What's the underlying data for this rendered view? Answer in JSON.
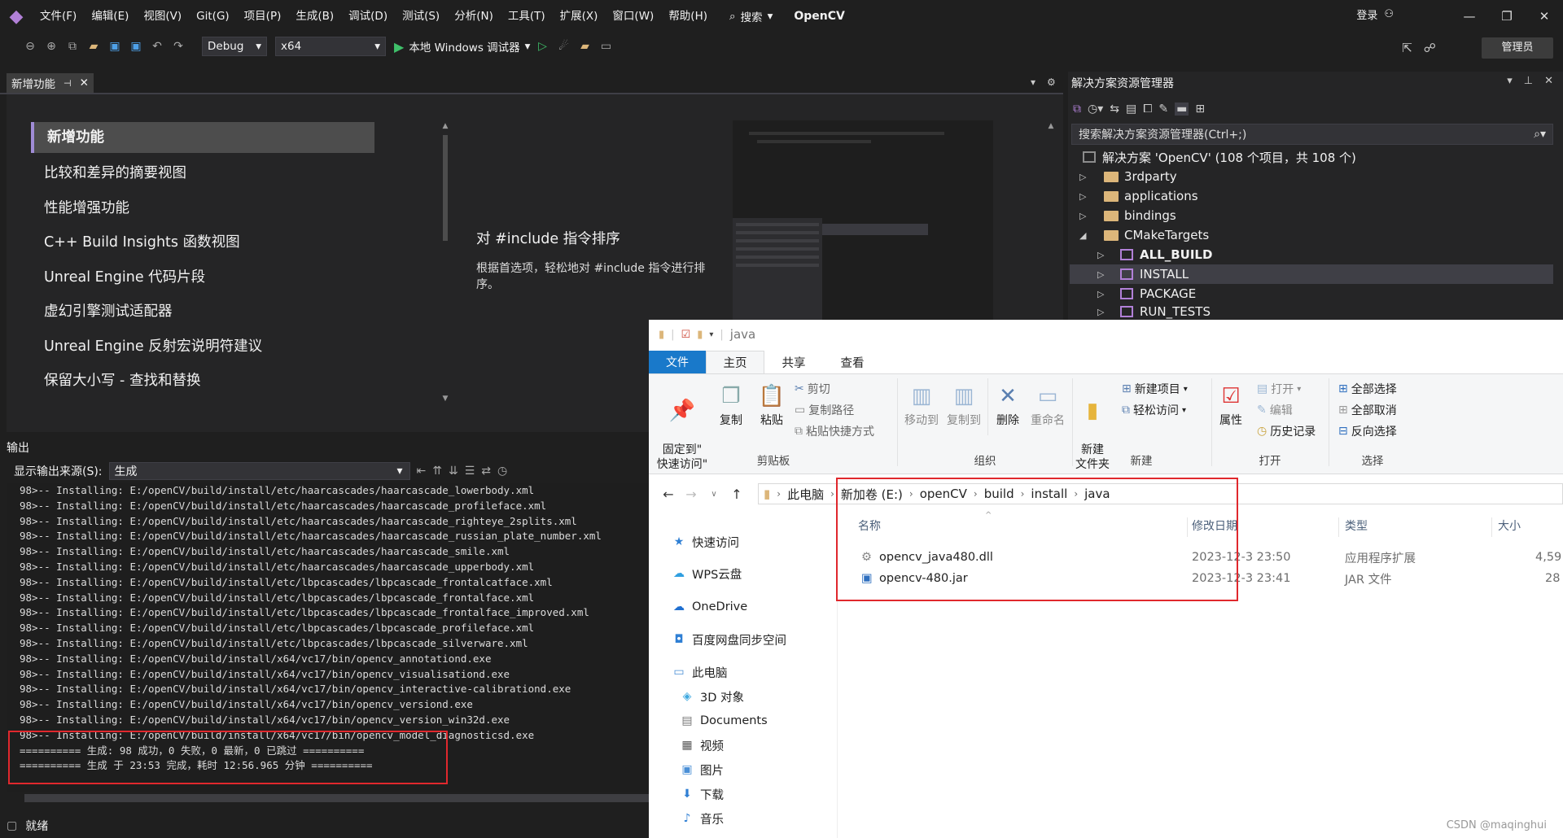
{
  "vs": {
    "menu": [
      "文件(F)",
      "编辑(E)",
      "视图(V)",
      "Git(G)",
      "项目(P)",
      "生成(B)",
      "调试(D)",
      "测试(S)",
      "分析(N)",
      "工具(T)",
      "扩展(X)",
      "窗口(W)",
      "帮助(H)"
    ],
    "search_label": "搜索",
    "solution_name": "OpenCV",
    "login_label": "登录",
    "config": "Debug",
    "platform": "x64",
    "run_label": "本地 Windows 调试器",
    "admin_label": "管理员"
  },
  "whats_new": {
    "tab_label": "新增功能",
    "items": [
      "新增功能",
      "比较和差异的摘要视图",
      "性能增强功能",
      "C++ Build Insights 函数视图",
      "Unreal Engine 代码片段",
      "虚幻引擎测试适配器",
      "Unreal Engine 反射宏说明符建议",
      "保留大小写 - 查找和替换"
    ],
    "feature_title": "对 #include 指令排序",
    "feature_desc": "根据首选项，轻松地对 #include 指令进行排序。"
  },
  "output": {
    "title": "输出",
    "source_label": "显示输出来源(S):",
    "source_value": "生成",
    "lines": [
      "98>-- Installing: E:/openCV/build/install/etc/haarcascades/haarcascade_lowerbody.xml",
      "98>-- Installing: E:/openCV/build/install/etc/haarcascades/haarcascade_profileface.xml",
      "98>-- Installing: E:/openCV/build/install/etc/haarcascades/haarcascade_righteye_2splits.xml",
      "98>-- Installing: E:/openCV/build/install/etc/haarcascades/haarcascade_russian_plate_number.xml",
      "98>-- Installing: E:/openCV/build/install/etc/haarcascades/haarcascade_smile.xml",
      "98>-- Installing: E:/openCV/build/install/etc/haarcascades/haarcascade_upperbody.xml",
      "98>-- Installing: E:/openCV/build/install/etc/lbpcascades/lbpcascade_frontalcatface.xml",
      "98>-- Installing: E:/openCV/build/install/etc/lbpcascades/lbpcascade_frontalface.xml",
      "98>-- Installing: E:/openCV/build/install/etc/lbpcascades/lbpcascade_frontalface_improved.xml",
      "98>-- Installing: E:/openCV/build/install/etc/lbpcascades/lbpcascade_profileface.xml",
      "98>-- Installing: E:/openCV/build/install/etc/lbpcascades/lbpcascade_silverware.xml",
      "98>-- Installing: E:/openCV/build/install/x64/vc17/bin/opencv_annotationd.exe",
      "98>-- Installing: E:/openCV/build/install/x64/vc17/bin/opencv_visualisationd.exe",
      "98>-- Installing: E:/openCV/build/install/x64/vc17/bin/opencv_interactive-calibrationd.exe",
      "98>-- Installing: E:/openCV/build/install/x64/vc17/bin/opencv_versiond.exe",
      "98>-- Installing: E:/openCV/build/install/x64/vc17/bin/opencv_version_win32d.exe",
      "98>-- Installing: E:/openCV/build/install/x64/vc17/bin/opencv_model_diagnosticsd.exe",
      "========== 生成: 98 成功，0 失败，0 最新，0 已跳过 ==========",
      "========== 生成 于 23:53 完成，耗时 12:56.965 分钟 =========="
    ]
  },
  "status": {
    "text": "就绪"
  },
  "solution_explorer": {
    "title": "解决方案资源管理器",
    "search_placeholder": "搜索解决方案资源管理器(Ctrl+;)",
    "solution_label": "解决方案 'OpenCV' (108 个项目，共 108 个)",
    "folders": [
      "3rdparty",
      "applications",
      "bindings",
      "CMakeTargets"
    ],
    "targets": [
      "ALL_BUILD",
      "INSTALL",
      "PACKAGE",
      "RUN_TESTS"
    ]
  },
  "explorer": {
    "window_title": "java",
    "tabs": [
      "文件",
      "主页",
      "共享",
      "查看"
    ],
    "ribbon": {
      "pin": "固定到\"\n快速访问\"",
      "copy": "复制",
      "paste": "粘贴",
      "cut": "剪切",
      "copy_path": "复制路径",
      "paste_shortcut": "粘贴快捷方式",
      "clipboard": "剪贴板",
      "move_to": "移动到",
      "copy_to": "复制到",
      "delete": "删除",
      "rename": "重命名",
      "organize": "组织",
      "new_folder": "新建\n文件夹",
      "new_item": "新建项目",
      "easy_access": "轻松访问",
      "new": "新建",
      "properties": "属性",
      "open": "打开",
      "edit": "编辑",
      "history": "历史记录",
      "open_group": "打开",
      "select_all": "全部选择",
      "select_none": "全部取消",
      "invert": "反向选择",
      "select": "选择"
    },
    "breadcrumb": [
      "此电脑",
      "新加卷 (E:)",
      "openCV",
      "build",
      "install",
      "java"
    ],
    "nav": [
      "快速访问",
      "WPS云盘",
      "OneDrive",
      "百度网盘同步空间",
      "此电脑",
      "3D 对象",
      "Documents",
      "视频",
      "图片",
      "下载",
      "音乐"
    ],
    "columns": [
      "名称",
      "修改日期",
      "类型",
      "大小"
    ],
    "files": [
      {
        "name": "opencv_java480.dll",
        "date": "2023-12-3 23:50",
        "type": "应用程序扩展",
        "size": "4,59"
      },
      {
        "name": "opencv-480.jar",
        "date": "2023-12-3 23:41",
        "type": "JAR 文件",
        "size": "28"
      }
    ]
  },
  "watermark": "CSDN @maqinghui",
  "colors": {
    "accent": "#b180d7",
    "highlight_border": "#e0282d",
    "explorer_file_tab": "#1979ca"
  }
}
